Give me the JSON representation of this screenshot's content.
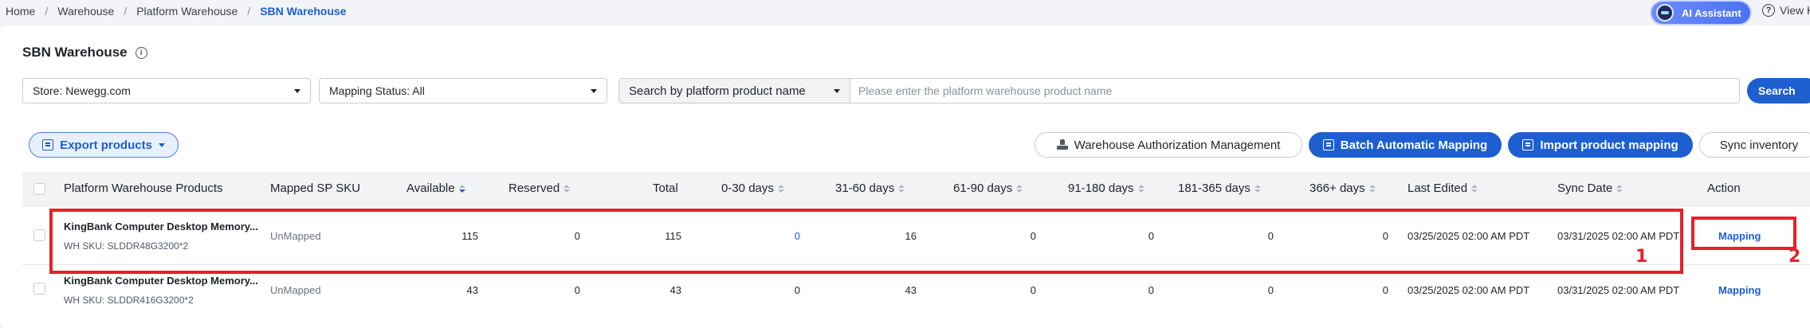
{
  "breadcrumb": [
    "Home",
    "Warehouse",
    "Platform Warehouse",
    "SBN Warehouse"
  ],
  "ai_assistant_label": "AI Assistant",
  "view_help_label": "View H",
  "page_title": "SBN Warehouse",
  "filters": {
    "store": "Store: Newegg.com",
    "mapping_status": "Mapping Status: All",
    "search_type": "Search by platform product name",
    "search_placeholder": "Please enter the platform warehouse product name",
    "search_button": "Search"
  },
  "toolbar": {
    "export": "Export products",
    "warehouse_auth": "Warehouse Authorization Management",
    "batch_mapping": "Batch Automatic Mapping",
    "import_mapping": "Import product mapping",
    "sync_inventory": "Sync inventory"
  },
  "table": {
    "headers": {
      "product": "Platform Warehouse Products",
      "mapped_sku": "Mapped SP SKU",
      "available": "Available",
      "reserved": "Reserved",
      "total": "Total",
      "d0_30": "0-30 days",
      "d31_60": "31-60 days",
      "d61_90": "61-90 days",
      "d91_180": "91-180 days",
      "d181_365": "181-365 days",
      "d366": "366+ days",
      "last_edited": "Last Edited",
      "sync_date": "Sync Date",
      "action": "Action"
    },
    "rows": [
      {
        "name": "KingBank Computer Desktop Memory...",
        "sku": "WH SKU: SLDDR48G3200*2",
        "mapped": "UnMapped",
        "available": "115",
        "reserved": "0",
        "total": "115",
        "d0_30": "0",
        "d31_60": "16",
        "d61_90": "0",
        "d91_180": "0",
        "d181_365": "0",
        "d366": "0",
        "last_edited": "03/25/2025 02:00 AM PDT",
        "sync_date": "03/31/2025 02:00 AM PDT",
        "action": "Mapping"
      },
      {
        "name": "KingBank Computer Desktop Memory...",
        "sku": "WH SKU: SLDDR416G3200*2",
        "mapped": "UnMapped",
        "available": "43",
        "reserved": "0",
        "total": "43",
        "d0_30": "0",
        "d31_60": "43",
        "d61_90": "0",
        "d91_180": "0",
        "d181_365": "0",
        "d366": "0",
        "last_edited": "03/25/2025 02:00 AM PDT",
        "sync_date": "03/31/2025 02:00 AM PDT",
        "action": "Mapping"
      }
    ]
  },
  "annotations": [
    "1",
    "2"
  ],
  "colors": {
    "accent": "#1d5fd1",
    "annotation": "#e8202a"
  }
}
